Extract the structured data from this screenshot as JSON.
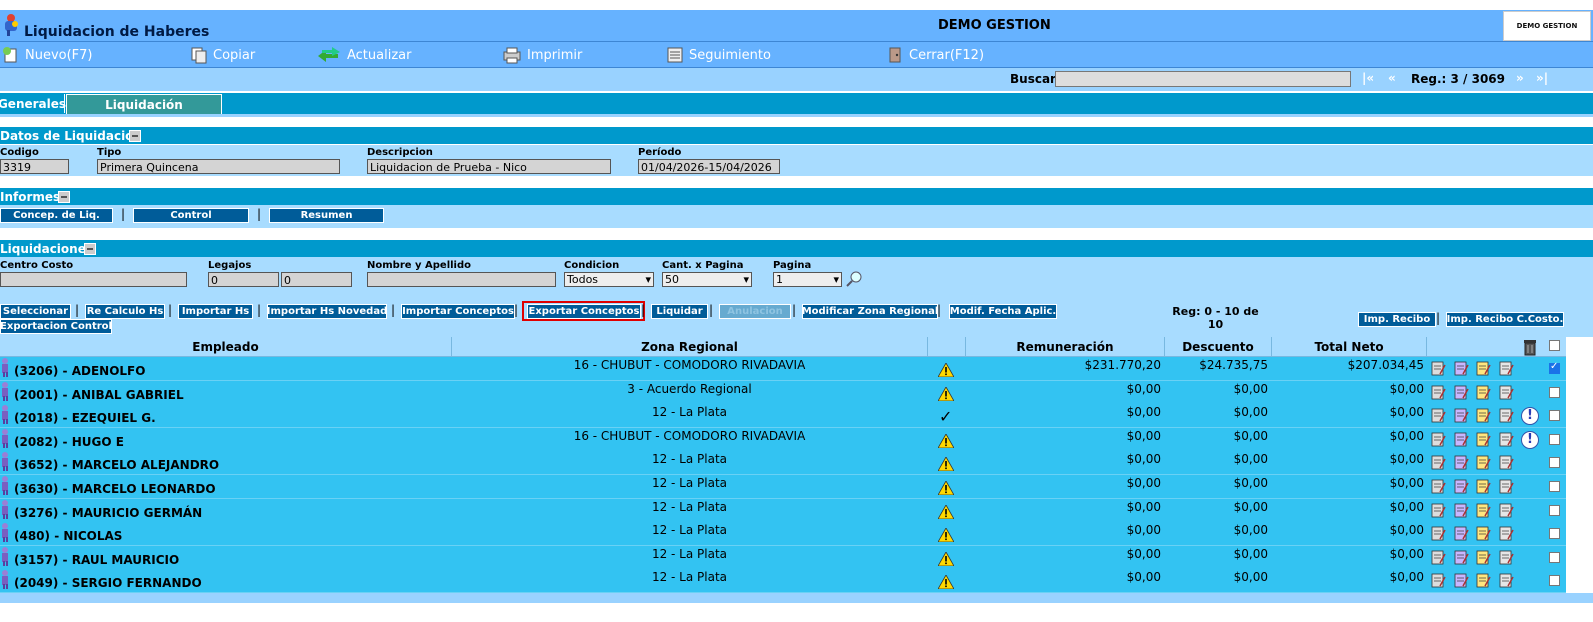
{
  "window": {
    "title": "Liquidacion de Haberes",
    "company": "DEMO GESTION",
    "brand": "DEMO GESTION"
  },
  "toolbar": {
    "nuevo": "Nuevo(F7)",
    "copiar": "Copiar",
    "actualizar": "Actualizar",
    "imprimir": "Imprimir",
    "seguimiento": "Seguimiento",
    "cerrar": "Cerrar(F12)"
  },
  "search": {
    "label": "Buscar",
    "value": "",
    "first": "|«",
    "prev": "«",
    "reg": "Reg.: 3 / 3069",
    "next": "»",
    "last": "»|"
  },
  "tabs": [
    "Generales",
    "Liquidación"
  ],
  "datos": {
    "title": "Datos de Liquidacion",
    "codigo_label": "Codigo",
    "codigo": "3319",
    "tipo_label": "Tipo",
    "tipo": "Primera Quincena",
    "descripcion_label": "Descripcion",
    "descripcion": "Liquidacion de Prueba - Nico",
    "periodo_label": "Período",
    "periodo": "01/04/2026-15/04/2026"
  },
  "informes": {
    "title": "Informes",
    "buttons": [
      "Concep. de Liq.",
      "Control",
      "Resumen"
    ]
  },
  "liquidaciones": {
    "title": "Liquidaciones",
    "centro_costo_label": "Centro Costo",
    "centro_costo": "",
    "legajos_label": "Legajos",
    "legajo_desde": "0",
    "legajo_hasta": "0",
    "nombre_label": "Nombre y Apellido",
    "nombre": "",
    "condicion_label": "Condicion",
    "condicion": "Todos",
    "cant_label": "Cant. x Pagina",
    "cant": "50",
    "pagina_label": "Pagina",
    "pagina": "1"
  },
  "actions": {
    "seleccionar": "Seleccionar",
    "recalculo": "Re Calculo Hs",
    "importar_hs": "Importar Hs",
    "importar_novedad": "Importar Hs Novedad",
    "importar_conceptos": "Importar Conceptos",
    "exportar_conceptos": "Exportar Conceptos",
    "liquidar": "Liquidar",
    "anular": "Anulacion",
    "modificar_zona": "Modificar Zona Regional",
    "modif_fecha": "Modif. Fecha Aplic.",
    "exportacion_control": "Exportacion Control",
    "reg_info": "Reg: 0 - 10 de 10",
    "imp_recibo": "Imp. Recibo",
    "imp_recibo_ccosto": "Imp. Recibo C.Costo."
  },
  "table": {
    "headers": {
      "empleado": "Empleado",
      "zona": "Zona Regional",
      "remuneracion": "Remuneración",
      "descuento": "Descuento",
      "neto": "Total Neto"
    },
    "rows": [
      {
        "empleado": "(3206) - ADENOLFO",
        "zona": "16 - CHUBUT - COMODORO RIVADAVIA",
        "status": "warning",
        "rem": "$231.770,20",
        "desc": "$24.735,75",
        "neto": "$207.034,45",
        "alert": false,
        "checked": true
      },
      {
        "empleado": "(2001) - ANIBAL GABRIEL",
        "zona": "3 - Acuerdo Regional",
        "status": "warning",
        "rem": "$0,00",
        "desc": "$0,00",
        "neto": "$0,00",
        "alert": false,
        "checked": false
      },
      {
        "empleado": "(2018) - EZEQUIEL G.",
        "zona": "12 - La Plata",
        "status": "ok",
        "rem": "$0,00",
        "desc": "$0,00",
        "neto": "$0,00",
        "alert": true,
        "checked": false
      },
      {
        "empleado": "(2082) - HUGO E",
        "zona": "16 - CHUBUT - COMODORO RIVADAVIA",
        "status": "warning",
        "rem": "$0,00",
        "desc": "$0,00",
        "neto": "$0,00",
        "alert": true,
        "checked": false
      },
      {
        "empleado": "(3652) - MARCELO ALEJANDRO",
        "zona": "12 - La Plata",
        "status": "warning",
        "rem": "$0,00",
        "desc": "$0,00",
        "neto": "$0,00",
        "alert": false,
        "checked": false
      },
      {
        "empleado": "(3630) - MARCELO LEONARDO",
        "zona": "12 - La Plata",
        "status": "warning",
        "rem": "$0,00",
        "desc": "$0,00",
        "neto": "$0,00",
        "alert": false,
        "checked": false
      },
      {
        "empleado": "(3276) - MAURICIO GERMÁN",
        "zona": "12 - La Plata",
        "status": "warning",
        "rem": "$0,00",
        "desc": "$0,00",
        "neto": "$0,00",
        "alert": false,
        "checked": false
      },
      {
        "empleado": "(480) - NICOLAS",
        "zona": "12 - La Plata",
        "status": "warning",
        "rem": "$0,00",
        "desc": "$0,00",
        "neto": "$0,00",
        "alert": false,
        "checked": false
      },
      {
        "empleado": "(3157) - RAUL MAURICIO",
        "zona": "12 - La Plata",
        "status": "warning",
        "rem": "$0,00",
        "desc": "$0,00",
        "neto": "$0,00",
        "alert": false,
        "checked": false
      },
      {
        "empleado": "(2049) - SERGIO FERNANDO",
        "zona": "12 - La Plata",
        "status": "warning",
        "rem": "$0,00",
        "desc": "$0,00",
        "neto": "$0,00",
        "alert": false,
        "checked": false
      }
    ]
  }
}
